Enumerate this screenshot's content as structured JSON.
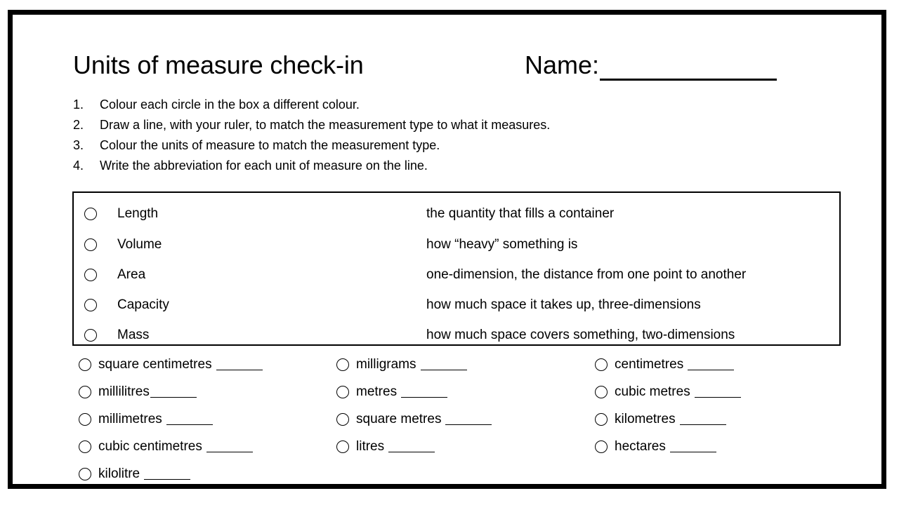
{
  "document": {
    "title": "Units of measure check-in",
    "name_label": "Name:",
    "name_value": ""
  },
  "instructions": [
    {
      "number": "1.",
      "text": "Colour each circle in the box a different colour."
    },
    {
      "number": "2.",
      "text": "Draw a line, with your ruler, to match the measurement type to what it measures."
    },
    {
      "number": "3.",
      "text": "Colour the units of measure to match the measurement type."
    },
    {
      "number": "4.",
      "text": "Write the abbreviation for each unit of measure on the line."
    }
  ],
  "matching": {
    "rows": [
      {
        "term": "Length",
        "definition": "the quantity that fills a container"
      },
      {
        "term": "Volume",
        "definition": "how “heavy” something is"
      },
      {
        "term": "Area",
        "definition": "one-dimension, the distance from one point to another"
      },
      {
        "term": "Capacity",
        "definition": "how much space it takes up, three-dimensions"
      },
      {
        "term": "Mass",
        "definition": "how much space covers something, two-dimensions"
      }
    ]
  },
  "units": {
    "blank": "______",
    "columns": [
      {
        "items": [
          {
            "label": "square centimetres"
          },
          {
            "label": "millilitres"
          },
          {
            "label": "millimetres"
          },
          {
            "label": "cubic centimetres"
          },
          {
            "label": "kilolitre"
          }
        ]
      },
      {
        "items": [
          {
            "label": "milligrams"
          },
          {
            "label": "metres"
          },
          {
            "label": "square metres"
          },
          {
            "label": "litres"
          }
        ]
      },
      {
        "items": [
          {
            "label": "centimetres"
          },
          {
            "label": "cubic metres"
          },
          {
            "label": "kilometres"
          },
          {
            "label": "hectares"
          }
        ]
      }
    ]
  },
  "colors": {
    "ink": "#000000",
    "page": "#ffffff"
  }
}
